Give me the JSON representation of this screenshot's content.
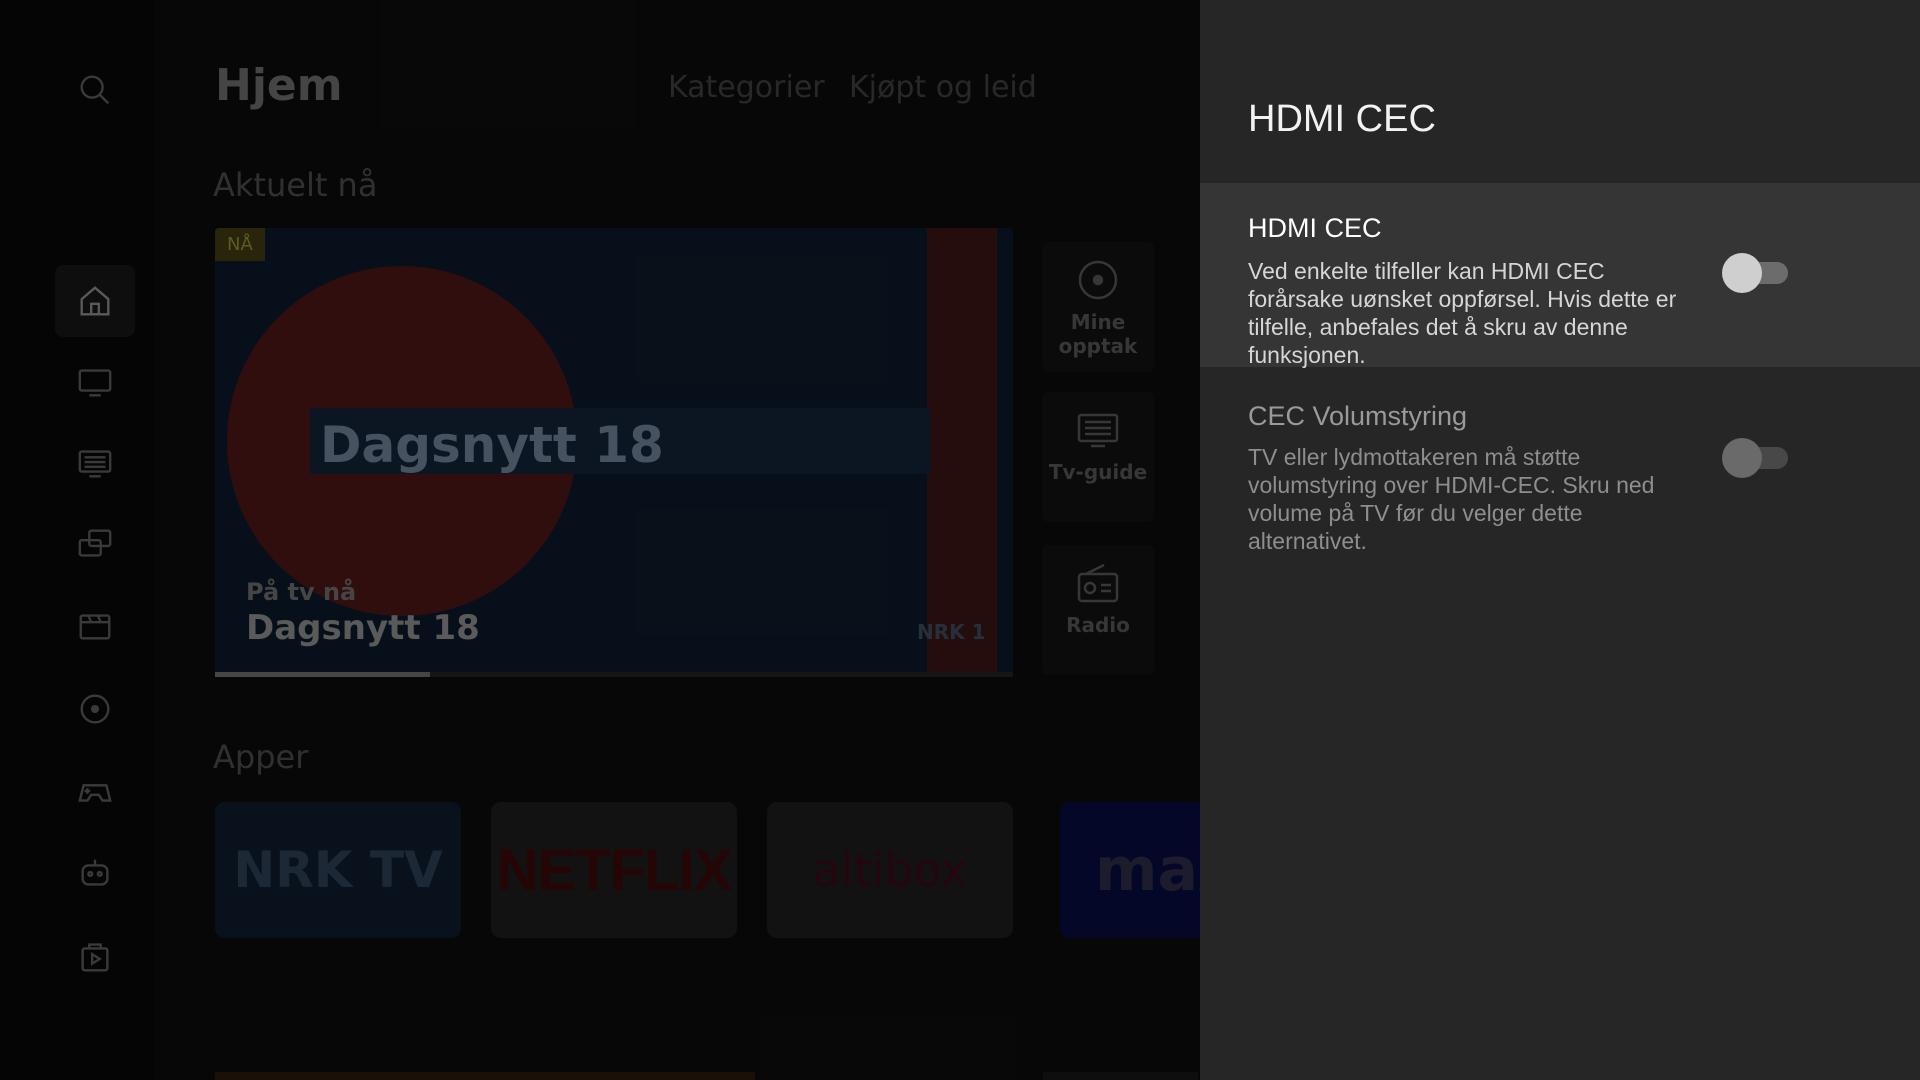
{
  "home": {
    "title": "Hjem",
    "tabs": [
      "Kategorier",
      "Kjøpt og leid"
    ],
    "rail_icons": [
      "search-icon",
      "home-icon",
      "tv-icon",
      "tv-guide-icon",
      "screens-icon",
      "movie-icon",
      "recording-icon",
      "gamepad-icon",
      "kids-icon",
      "play-store-icon"
    ],
    "sections": {
      "aktuelt": "Aktuelt nå",
      "apper": "Apper"
    },
    "hero": {
      "badge": "NÅ",
      "logo_text": "Dagsnytt 18",
      "caption": "På tv nå",
      "title": "Dagsnytt 18",
      "channel": "NRK 1",
      "progress": 0.27
    },
    "shortcuts": [
      {
        "label": "Mine opptak",
        "icon": "recording-icon"
      },
      {
        "label": "Tv-guide",
        "icon": "tv-guide-icon"
      },
      {
        "label": "Radio",
        "icon": "radio-icon"
      }
    ],
    "apps": [
      "NRK TV",
      "NETFLIX",
      "altibox",
      "max"
    ]
  },
  "panel": {
    "title": "HDMI CEC",
    "settings": [
      {
        "label": "HDMI CEC",
        "description": "Ved enkelte tilfeller kan HDMI CEC forårsake uønsket oppførsel. Hvis dette er tilfelle, anbefales det å skru av denne funksjonen.",
        "enabled": false,
        "focused": true
      },
      {
        "label": "CEC Volumstyring",
        "description": "TV eller lydmottakeren må støtte volumstyring over HDMI-CEC. Skru ned volume på TV før du velger dette alternativet.",
        "enabled": false,
        "focused": false
      }
    ]
  },
  "colors": {
    "panel_bg": "#262626",
    "focused_row_bg": "#353535",
    "dimmed_overlay": "#000000"
  }
}
